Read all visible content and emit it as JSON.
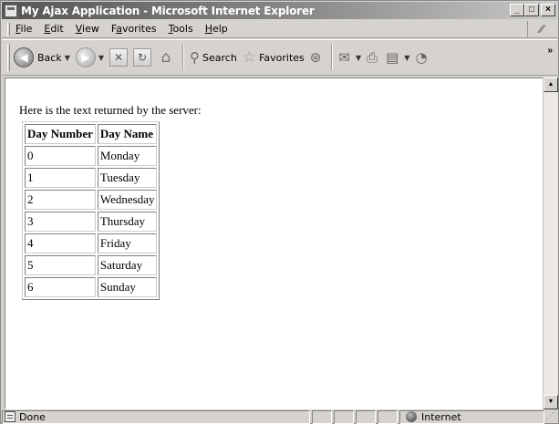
{
  "window": {
    "title": "My Ajax Application - Microsoft Internet Explorer",
    "minimize_glyph": "_",
    "maximize_glyph": "□",
    "close_glyph": "×"
  },
  "menu": {
    "items": [
      {
        "accel": "F",
        "rest": "ile"
      },
      {
        "accel": "E",
        "rest": "dit"
      },
      {
        "accel": "V",
        "rest": "iew"
      },
      {
        "pre": "F",
        "accel": "a",
        "rest": "vorites"
      },
      {
        "accel": "T",
        "rest": "ools"
      },
      {
        "accel": "H",
        "rest": "elp"
      }
    ]
  },
  "toolbar": {
    "back_label": "Back",
    "search_label": "Search",
    "favorites_label": "Favorites",
    "back_glyph": "◀",
    "forward_glyph": "▶",
    "stop_glyph": "✕",
    "refresh_glyph": "↻",
    "home_glyph": "⌂",
    "search_glyph": "⚲",
    "favorites_glyph": "☆",
    "history_glyph": "⊛",
    "mail_glyph": "✉",
    "print_glyph": "⎙",
    "edit_glyph": "▤",
    "messenger_glyph": "◔",
    "dropdown_glyph": "▼",
    "more_glyph": "»"
  },
  "content": {
    "intro": "Here is the text returned by the server:",
    "table": {
      "headers": [
        "Day Number",
        "Day Name"
      ],
      "rows": [
        [
          "0",
          "Monday"
        ],
        [
          "1",
          "Tuesday"
        ],
        [
          "2",
          "Wednesday"
        ],
        [
          "3",
          "Thursday"
        ],
        [
          "4",
          "Friday"
        ],
        [
          "5",
          "Saturday"
        ],
        [
          "6",
          "Sunday"
        ]
      ]
    }
  },
  "scrollbar": {
    "up_glyph": "▲",
    "down_glyph": "▼"
  },
  "status": {
    "text": "Done",
    "zone": "Internet",
    "corner_glyph": "⋰"
  }
}
